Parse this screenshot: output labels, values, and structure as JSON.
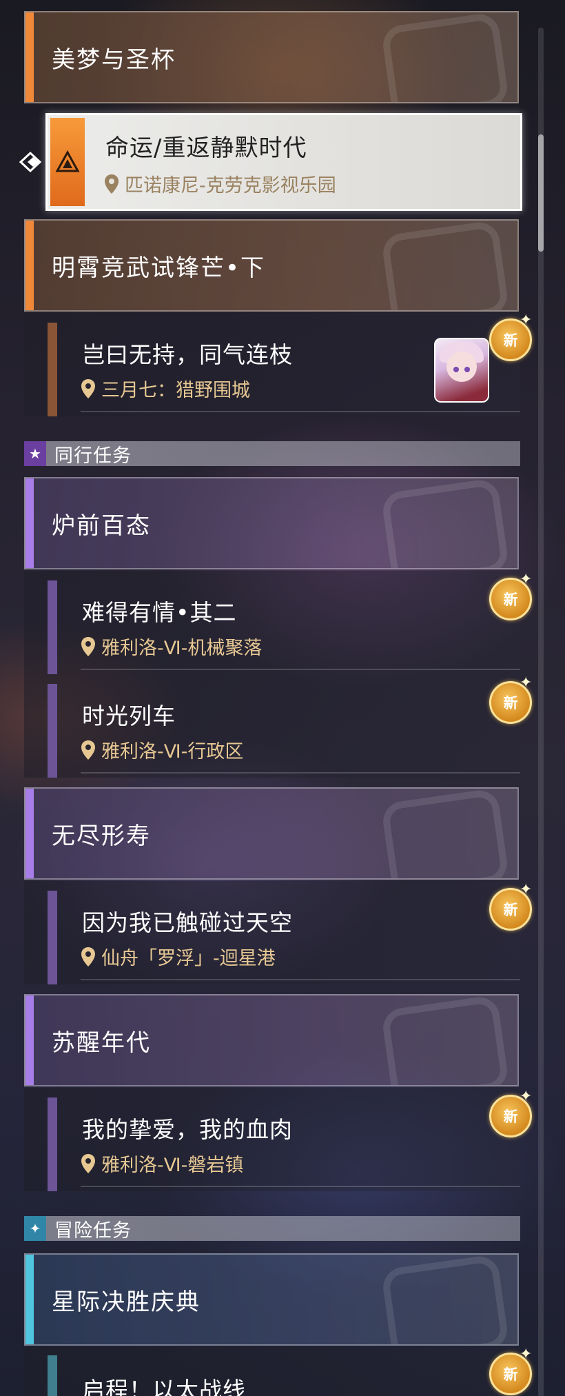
{
  "groups_top": [
    {
      "title": "美梦与圣杯",
      "color": "#f0883a"
    },
    {
      "title": "明霄竞武试锋芒•下",
      "color": "#f0883a"
    }
  ],
  "selected_quest": {
    "title": "命运/重返静默时代",
    "location": "匹诺康尼-克劳克影视乐园"
  },
  "trailblaze_item": {
    "title": "岂曰无持，同气连枝",
    "location": "三月七：猎野围城",
    "new_label": "新"
  },
  "section_companion": {
    "label": "同行任务",
    "icon": "star-icon"
  },
  "companion_groups": [
    {
      "title": "炉前百态",
      "items": [
        {
          "title": "难得有情•其二",
          "location": "雅利洛-Ⅵ-机械聚落",
          "new_label": "新"
        },
        {
          "title": "时光列车",
          "location": "雅利洛-Ⅵ-行政区",
          "new_label": "新"
        }
      ]
    },
    {
      "title": "无尽形寿",
      "items": [
        {
          "title": "因为我已触碰过天空",
          "location": "仙舟「罗浮」-迴星港",
          "new_label": "新"
        }
      ]
    },
    {
      "title": "苏醒年代",
      "items": [
        {
          "title": "我的挚爱，我的血肉",
          "location": "雅利洛-Ⅵ-磐岩镇",
          "new_label": "新"
        }
      ]
    }
  ],
  "section_adventure": {
    "label": "冒险任务",
    "icon": "compass-star-icon"
  },
  "adventure_groups": [
    {
      "title": "星际决胜庆典",
      "items": [
        {
          "title": "启程！以太战线",
          "new_label": "新"
        }
      ]
    }
  ],
  "colors": {
    "main_accent": "#f0883a",
    "companion_accent": "#a77ee8",
    "adventure_accent": "#4fc5e0",
    "location_text": "#e7c893"
  }
}
